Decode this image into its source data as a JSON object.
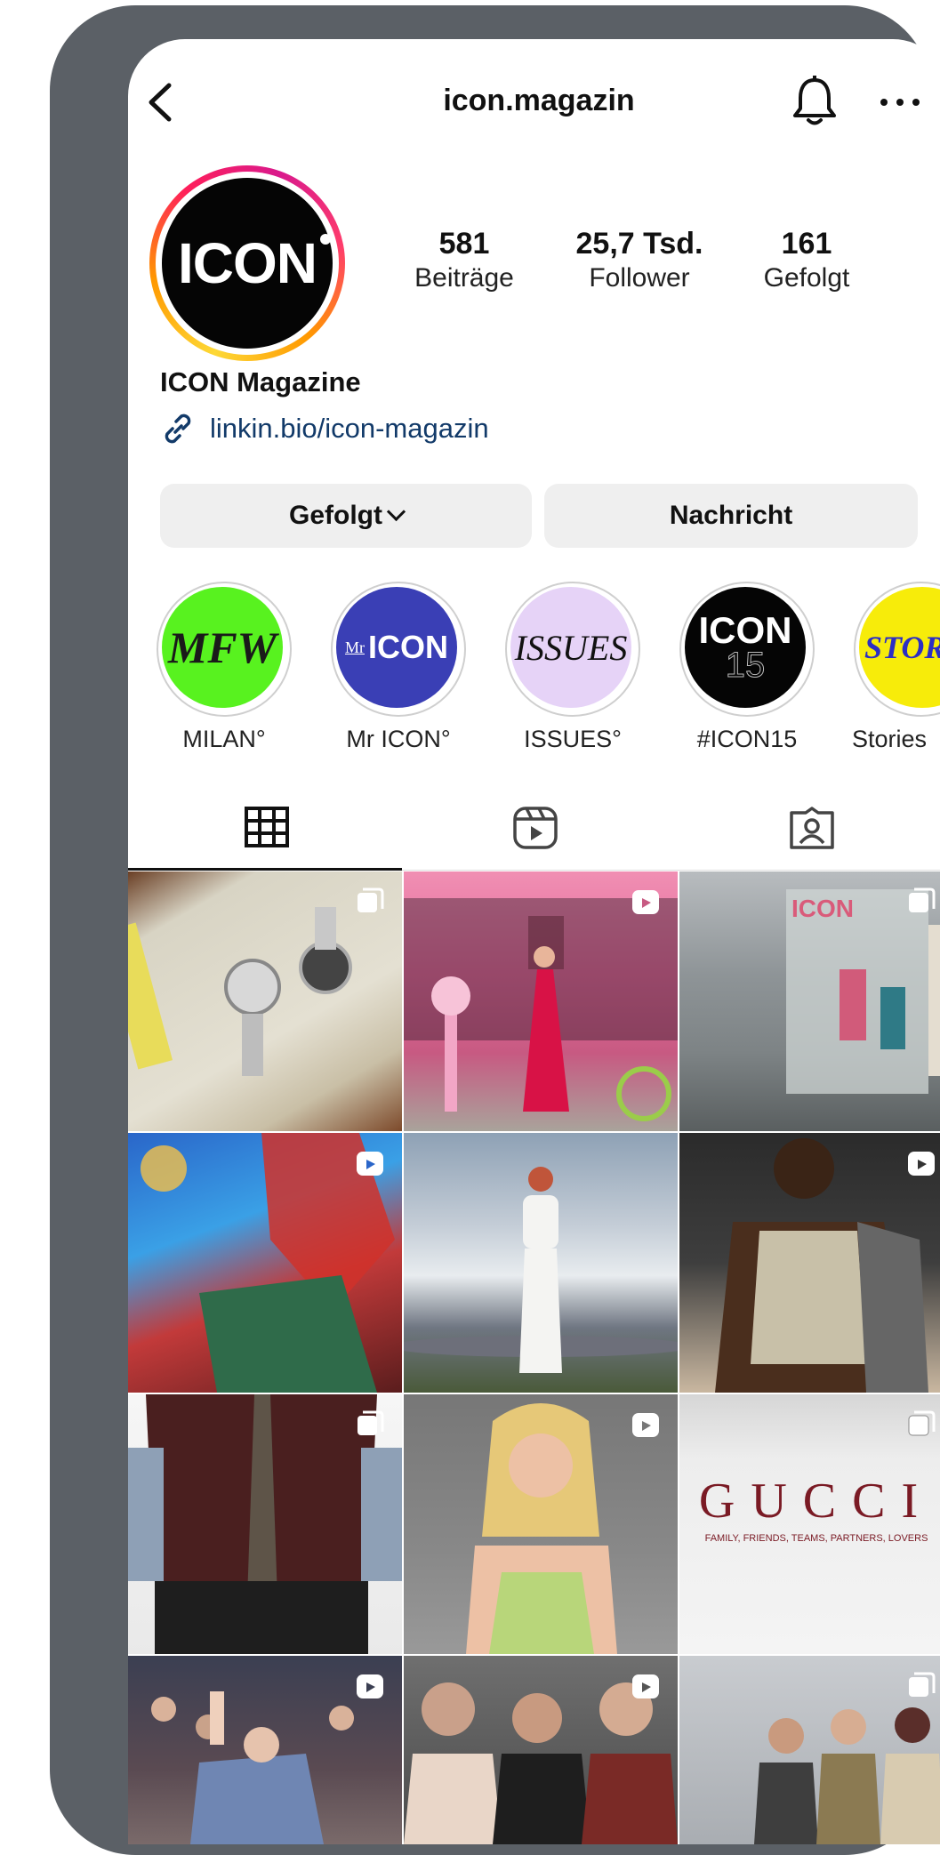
{
  "header": {
    "username": "icon.magazin"
  },
  "profile": {
    "avatar_text": "ICON",
    "stats": [
      {
        "value": "581",
        "label": "Beiträge"
      },
      {
        "value": "25,7 Tsd.",
        "label": "Follower"
      },
      {
        "value": "161",
        "label": "Gefolgt"
      }
    ],
    "name": "ICON Magazine",
    "link": "linkin.bio/icon-magazin"
  },
  "buttons": {
    "follow": "Gefolgt",
    "message": "Nachricht"
  },
  "highlights": [
    {
      "cover": "MFW",
      "label": "MILAN°",
      "bg": "#58f21f",
      "fg": "#1a1a1a"
    },
    {
      "cover": "ICON",
      "prefix": "Mr",
      "label": "Mr ICON°",
      "bg": "#3a3fb5",
      "fg": "#ffffff"
    },
    {
      "cover": "ISSUES",
      "label": "ISSUES°",
      "bg": "#e6d3f7",
      "fg": "#111111"
    },
    {
      "cover": "ICON",
      "sub": "15",
      "label": "#ICON15",
      "bg": "#050505",
      "fg": "#ffffff"
    },
    {
      "cover": "STORIES",
      "label": "Stories",
      "bg": "#f7ec0a",
      "fg": "#2c2ec4"
    }
  ],
  "tabs": [
    "grid-icon",
    "reels-icon",
    "tagged-icon"
  ],
  "posts": [
    {
      "desc": "watches on book",
      "badge": "carousel-icon",
      "text": ""
    },
    {
      "desc": "pink storefront",
      "badge": "reel-icon",
      "text": ""
    },
    {
      "desc": "magazine display",
      "badge": "carousel-icon",
      "text": "ICON"
    },
    {
      "desc": "colorful portrait",
      "badge": "reel-icon",
      "text": ""
    },
    {
      "desc": "white dress sky",
      "badge": "",
      "text": ""
    },
    {
      "desc": "runway model",
      "badge": "reel-icon",
      "text": ""
    },
    {
      "desc": "shirt and tie",
      "badge": "carousel-icon",
      "text": ""
    },
    {
      "desc": "blonde woman",
      "badge": "reel-icon",
      "text": ""
    },
    {
      "desc": "gucci tee",
      "badge": "carousel-icon",
      "text": "GUCCI",
      "subtext": "FAMILY, FRIENDS, TEAMS, PARTNERS, LOVERS"
    },
    {
      "desc": "audience waving",
      "badge": "reel-icon",
      "text": ""
    },
    {
      "desc": "group fashion",
      "badge": "reel-icon",
      "text": ""
    },
    {
      "desc": "group men",
      "badge": "carousel-icon",
      "text": ""
    }
  ]
}
